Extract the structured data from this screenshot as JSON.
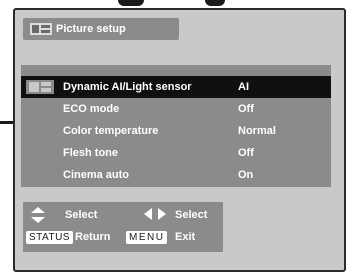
{
  "title": {
    "label": "Picture setup",
    "icon": "picture-setup-icon"
  },
  "menu": {
    "items": [
      {
        "label": "Dynamic AI/Light sensor",
        "value": "AI",
        "selected": true
      },
      {
        "label": "ECO mode",
        "value": "Off"
      },
      {
        "label": "Color temperature",
        "value": "Normal"
      },
      {
        "label": "Flesh tone",
        "value": "Off"
      },
      {
        "label": "Cinema auto",
        "value": "On"
      }
    ]
  },
  "footer": {
    "updown_label": "Select",
    "leftright_label": "Select",
    "status_key": "STATUS",
    "status_label": "Return",
    "menu_key": "MENU",
    "menu_label": "Exit"
  },
  "colors": {
    "panel": "#c9c9c9",
    "bar": "#8b8b8b",
    "selected": "#101010",
    "text": "#ffffff"
  }
}
